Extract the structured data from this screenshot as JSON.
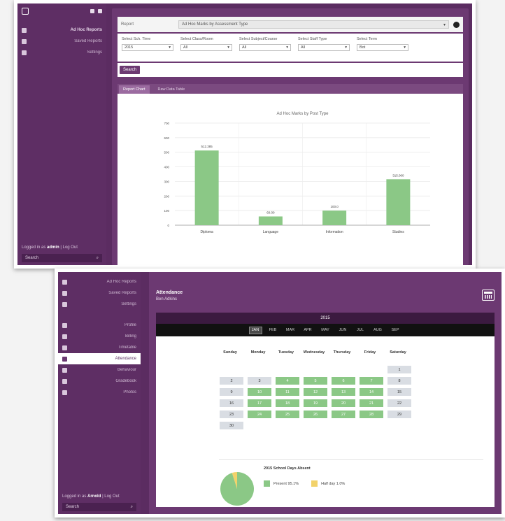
{
  "screen1": {
    "sidebar": {
      "items": [
        {
          "icon": "document-icon",
          "label": "Ad Hoc Reports",
          "bold": true
        },
        {
          "icon": "chart-icon",
          "label": "Saved Reports",
          "bold": false
        },
        {
          "icon": "settings-icon",
          "label": "Settings",
          "bold": false
        }
      ],
      "login_text": "Logged in as",
      "login_user": "admin",
      "logout_text": "| Log Out",
      "search_label": "Search"
    },
    "filter": {
      "label": "Report",
      "selected_report": "Ad Hoc Marks by Assessment Type"
    },
    "fields": [
      {
        "label": "Select Sch. Time",
        "value": "2015"
      },
      {
        "label": "Select Class/Room",
        "value": "All"
      },
      {
        "label": "Select Subject/Course",
        "value": "All"
      },
      {
        "label": "Select Staff Type",
        "value": "All"
      },
      {
        "label": "Select Term",
        "value": "Bot"
      }
    ],
    "search_button": "Search",
    "tabs": [
      "Report Chart",
      "Raw Data Table"
    ],
    "colors": {
      "bar": "#8bc886",
      "purple": "#6c3972"
    }
  },
  "chart_data": {
    "type": "bar",
    "title": "Ad Hoc Marks by Post Type",
    "categories": [
      "Diploma",
      "Language",
      "Information",
      "Studies"
    ],
    "values": [
      512,
      60,
      100,
      315
    ],
    "data_labels": [
      "512.385",
      "60.00",
      "100.0",
      "315.000"
    ],
    "ylim": [
      0,
      700
    ],
    "yticks": [
      0,
      100,
      200,
      300,
      400,
      500,
      600,
      700
    ],
    "xlabel": "",
    "ylabel": "",
    "grid": true
  },
  "screen2": {
    "sidebar": {
      "items": [
        {
          "icon": "document-icon",
          "label": "Ad Hoc Reports",
          "active": false
        },
        {
          "icon": "chart-icon",
          "label": "Saved Reports",
          "active": false
        },
        {
          "icon": "settings-icon",
          "label": "Settings",
          "active": false
        },
        {
          "icon": "profile-icon",
          "label": "Profile",
          "active": false
        },
        {
          "icon": "bill-icon",
          "label": "Billing",
          "active": false
        },
        {
          "icon": "timetable-icon",
          "label": "Timetable",
          "active": false
        },
        {
          "icon": "attendance-icon",
          "label": "Attendance",
          "active": true
        },
        {
          "icon": "behaviour-icon",
          "label": "Behaviour",
          "active": false
        },
        {
          "icon": "gradebook-icon",
          "label": "Gradebook",
          "active": false
        },
        {
          "icon": "photos-icon",
          "label": "Photos",
          "active": false
        }
      ],
      "login_text": "Logged in as",
      "login_user": "Arnold",
      "logout_text": "| Log Out",
      "search_label": "Search"
    },
    "title": "Attendance",
    "student": "Ben Adkins",
    "year": "2015",
    "months": [
      "JAN",
      "FEB",
      "MAR",
      "APR",
      "MAY",
      "JUN",
      "JUL",
      "AUG",
      "SEP"
    ],
    "active_month": 0,
    "weekdays": [
      "Sunday",
      "Monday",
      "Tuesday",
      "Wednesday",
      "Thursday",
      "Friday",
      "Saturday"
    ],
    "weeks": [
      [
        [
          "",
          "empty"
        ],
        [
          "",
          "empty"
        ],
        [
          "",
          "empty"
        ],
        [
          "",
          "empty"
        ],
        [
          "",
          "empty"
        ],
        [
          "",
          "empty"
        ],
        [
          "1",
          "absent"
        ]
      ],
      [
        [
          "2",
          "absent"
        ],
        [
          "3",
          "absent"
        ],
        [
          "4",
          "present"
        ],
        [
          "5",
          "present"
        ],
        [
          "6",
          "present"
        ],
        [
          "7",
          "present"
        ],
        [
          "8",
          "absent"
        ]
      ],
      [
        [
          "9",
          "absent"
        ],
        [
          "10",
          "present"
        ],
        [
          "11",
          "present"
        ],
        [
          "12",
          "present"
        ],
        [
          "13",
          "present"
        ],
        [
          "14",
          "present"
        ],
        [
          "15",
          "absent"
        ]
      ],
      [
        [
          "16",
          "absent"
        ],
        [
          "17",
          "present"
        ],
        [
          "18",
          "present"
        ],
        [
          "19",
          "present"
        ],
        [
          "20",
          "present"
        ],
        [
          "21",
          "present"
        ],
        [
          "22",
          "absent"
        ]
      ],
      [
        [
          "23",
          "absent"
        ],
        [
          "24",
          "present"
        ],
        [
          "25",
          "present"
        ],
        [
          "26",
          "present"
        ],
        [
          "27",
          "present"
        ],
        [
          "28",
          "present"
        ],
        [
          "29",
          "absent"
        ]
      ],
      [
        [
          "30",
          "absent"
        ],
        [
          "",
          "empty"
        ],
        [
          "",
          "empty"
        ],
        [
          "",
          "empty"
        ],
        [
          "",
          "empty"
        ],
        [
          "",
          "empty"
        ],
        [
          "",
          "empty"
        ]
      ]
    ],
    "summary": {
      "title": "2015 School Days Absent",
      "present_label": "Present 95.1%",
      "absent_label": "Half day 1.0%",
      "present_fraction": 0.951,
      "present_color": "#8bc886",
      "absent_color": "#f2d26a"
    }
  }
}
